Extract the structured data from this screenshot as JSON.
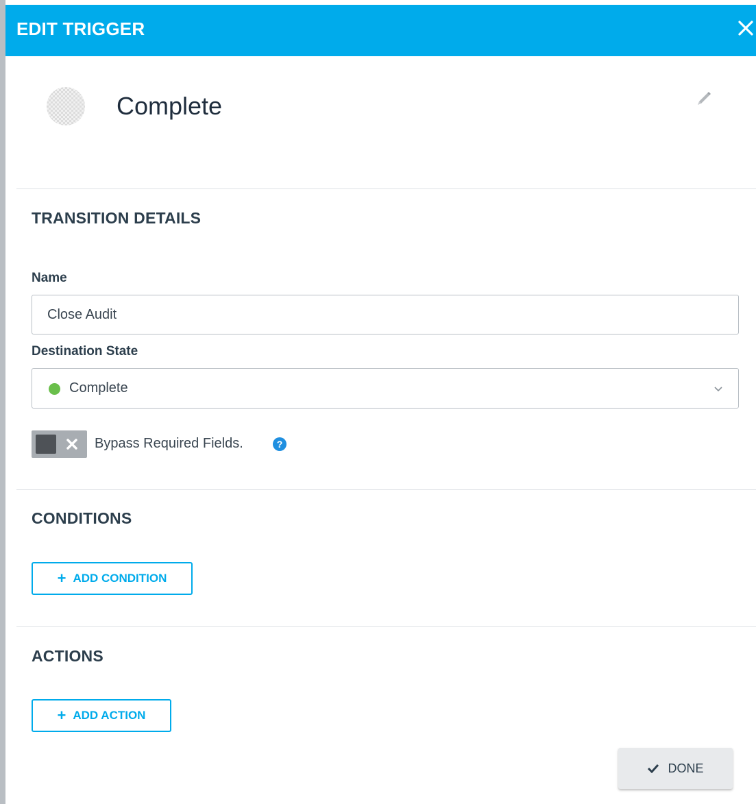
{
  "header": {
    "title": "EDIT TRIGGER",
    "close_icon": "close-icon"
  },
  "record": {
    "title": "Complete",
    "avatar_icon": "placeholder-avatar",
    "edit_icon": "pencil-icon"
  },
  "transition_details": {
    "section_title": "TRANSITION DETAILS",
    "name_label": "Name",
    "name_value": "Close Audit",
    "destination_label": "Destination State",
    "destination_value": "Complete",
    "destination_status_color": "#6abf4b",
    "bypass_label": "Bypass Required Fields.",
    "bypass_enabled": false,
    "help_glyph": "?"
  },
  "conditions": {
    "section_title": "CONDITIONS",
    "add_label": "ADD CONDITION"
  },
  "actions": {
    "section_title": "ACTIONS",
    "add_label": "ADD ACTION"
  },
  "footer": {
    "done_label": "DONE"
  },
  "colors": {
    "accent": "#00abeb",
    "help": "#1f8fe0",
    "toggle_off": "#a8adb2"
  }
}
